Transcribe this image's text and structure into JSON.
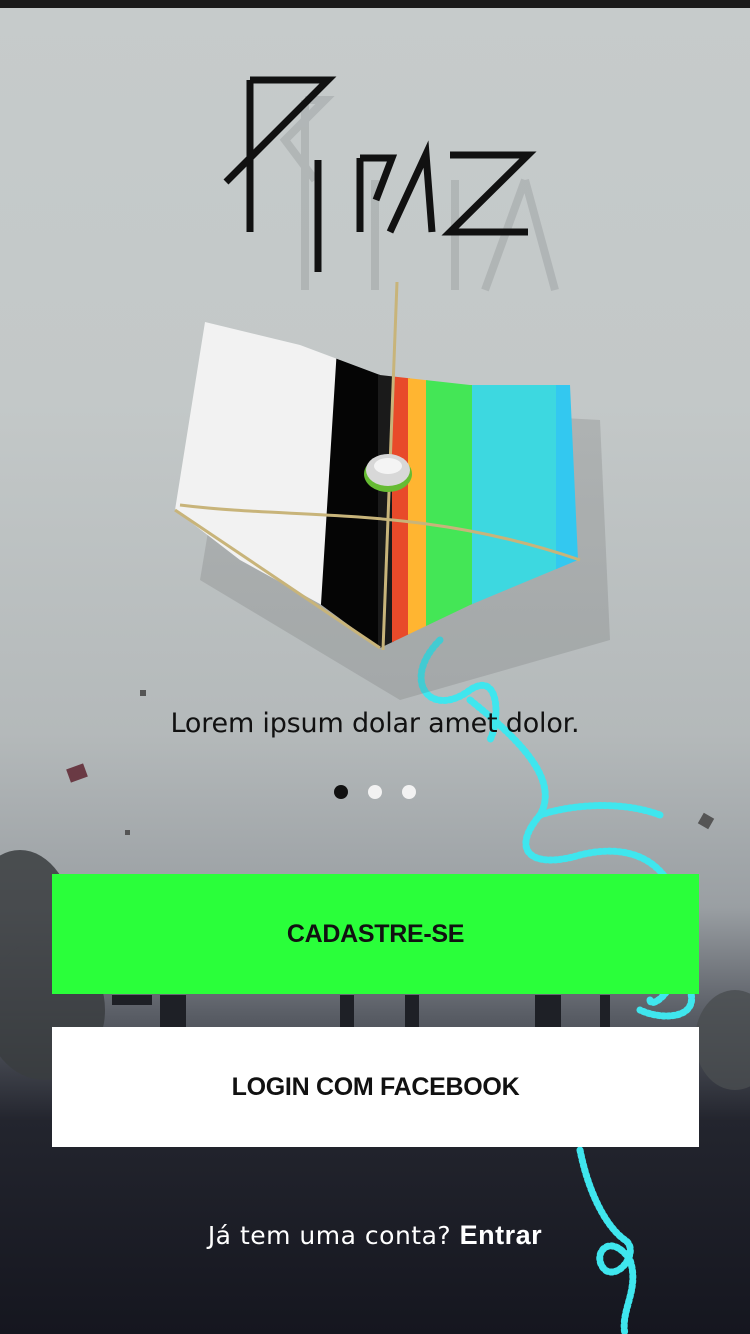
{
  "app": {
    "logo_text": "PIPAS"
  },
  "onboarding": {
    "tagline": "Lorem ipsum dolar amet dolor.",
    "page_count": 3,
    "active_page": 1
  },
  "actions": {
    "signup_label": "CADASTRE-SE",
    "facebook_label": "LOGIN COM FACEBOOK"
  },
  "footer": {
    "prompt": "Já tem uma conta?",
    "login_label": "Entrar"
  },
  "colors": {
    "signup_button": "#2aff3a",
    "facebook_button": "#ffffff",
    "kite_string": "#3fe6ee"
  }
}
